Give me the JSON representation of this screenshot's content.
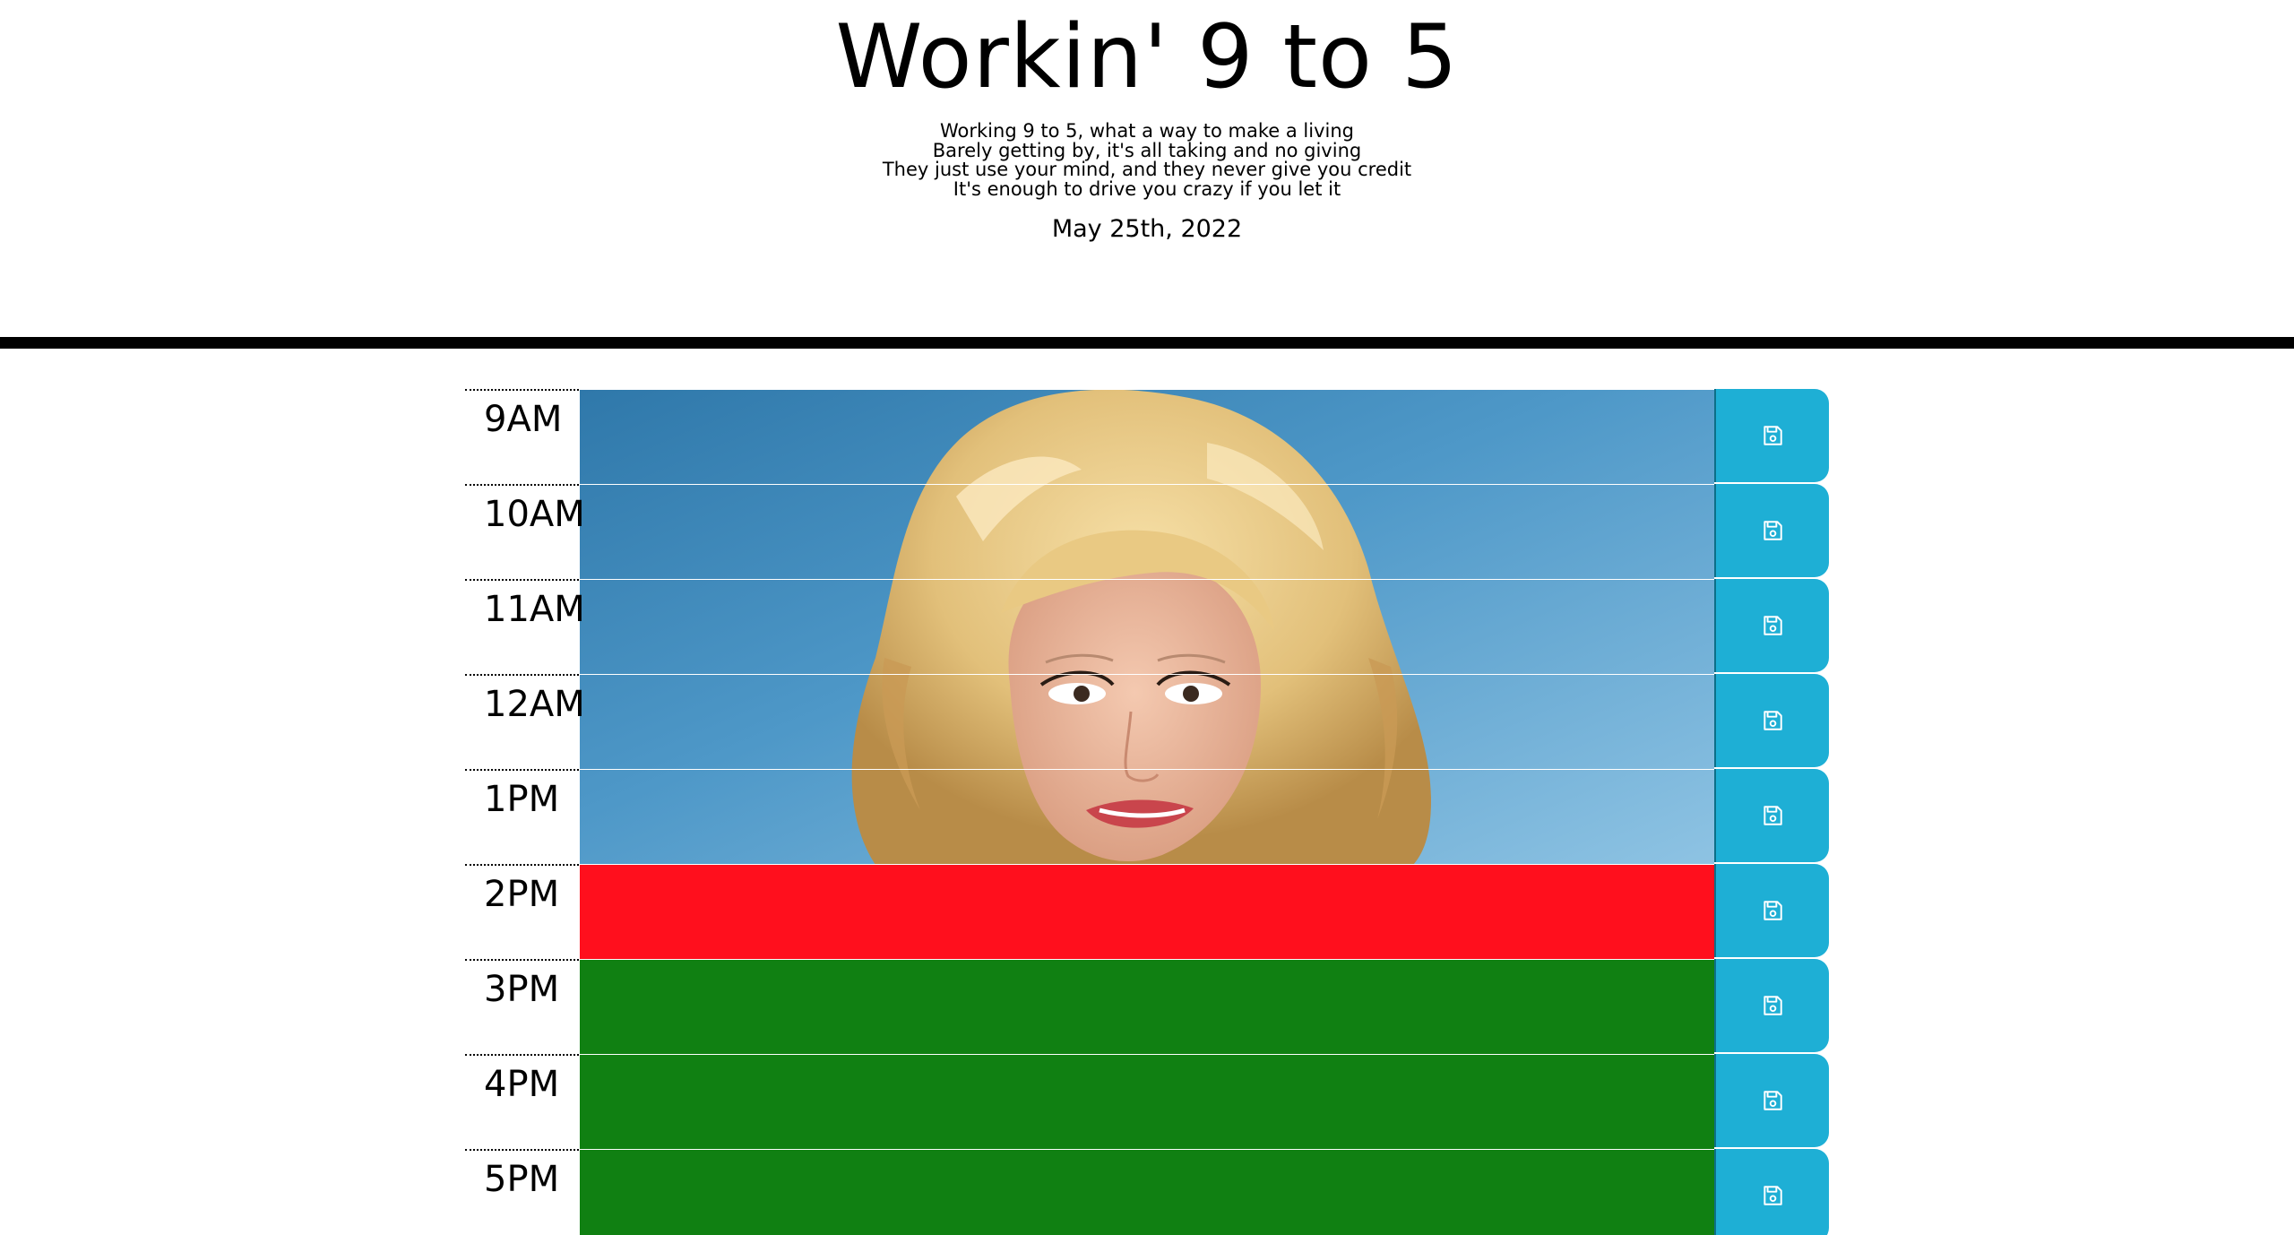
{
  "header": {
    "title": "Workin' 9 to 5",
    "lyrics": [
      "Working 9 to 5, what a way to make a living",
      "Barely getting by, it's all taking and no giving",
      "They just use your mind, and they never give you credit",
      "It's enough to drive you crazy if you let it"
    ],
    "date": "May 25th, 2022"
  },
  "colors": {
    "past_background": "portrait-photo",
    "present": "#ff0f1d",
    "future": "#108012",
    "save_button": "#1eafd5"
  },
  "planner": {
    "save_icon": "floppy-disk-icon",
    "rows": [
      {
        "hour": "9AM",
        "status": "past",
        "text": ""
      },
      {
        "hour": "10AM",
        "status": "past",
        "text": ""
      },
      {
        "hour": "11AM",
        "status": "past",
        "text": ""
      },
      {
        "hour": "12AM",
        "status": "past",
        "text": ""
      },
      {
        "hour": "1PM",
        "status": "past",
        "text": ""
      },
      {
        "hour": "2PM",
        "status": "present",
        "text": ""
      },
      {
        "hour": "3PM",
        "status": "future",
        "text": ""
      },
      {
        "hour": "4PM",
        "status": "future",
        "text": ""
      },
      {
        "hour": "5PM",
        "status": "future",
        "text": ""
      }
    ]
  }
}
